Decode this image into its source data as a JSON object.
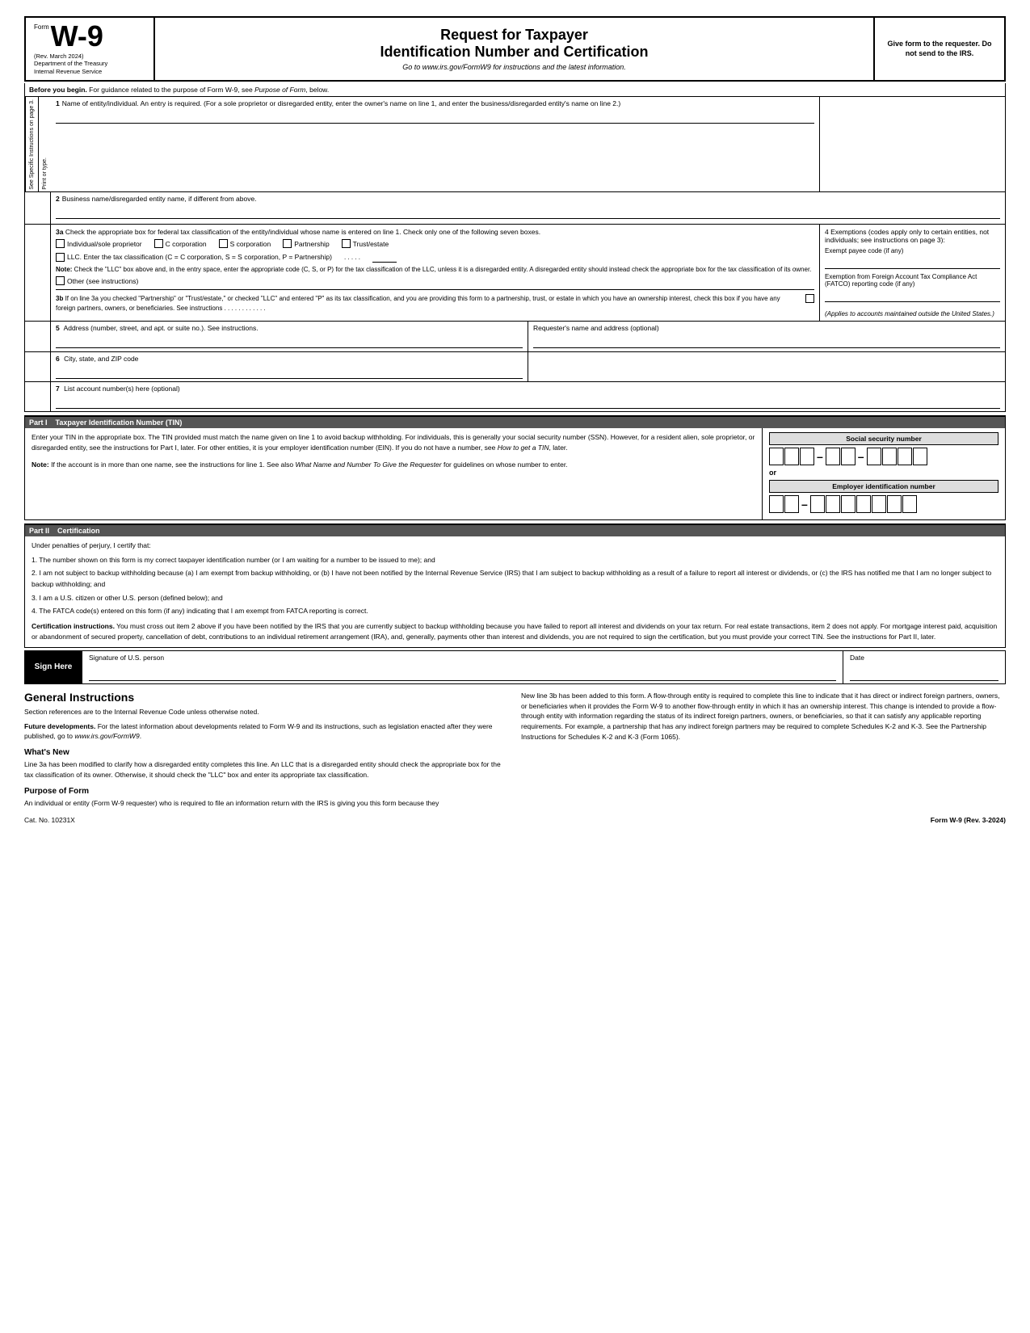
{
  "header": {
    "form_label": "Form",
    "form_number": "W-9",
    "rev_date": "(Rev. March 2024)",
    "dept1": "Department of the Treasury",
    "dept2": "Internal Revenue Service",
    "main_title": "Request for Taxpayer",
    "sub_title": "Identification Number and Certification",
    "go_to_text": "Go to ",
    "go_to_url": "www.irs.gov/FormW9",
    "go_to_suffix": " for instructions and the latest information.",
    "give_form": "Give form to the requester. Do not send to the IRS."
  },
  "before_begin": {
    "label": "Before you begin.",
    "text": " For guidance related to the purpose of Form W-9, see ",
    "italic": "Purpose of Form",
    "suffix": ", below."
  },
  "fields": {
    "field1_num": "1",
    "field1_label": "Name of entity/individual. An entry is required. (For a sole proprietor or disregarded entity, enter the owner's name on line 1, and enter the business/disregarded entity's name on line 2.)",
    "field2_num": "2",
    "field2_label": "Business name/disregarded entity name, if different from above.",
    "field3a_num": "3a",
    "field3a_label": "Check the appropriate box for federal tax classification of the entity/individual whose name is entered on line 1. Check only one of the following seven boxes.",
    "cb_individual": "Individual/sole proprietor",
    "cb_ccorp": "C corporation",
    "cb_scorp": "S corporation",
    "cb_partnership": "Partnership",
    "cb_trust": "Trust/estate",
    "llc_label": "LLC. Enter the tax classification (C = C corporation, S = S corporation, P = Partnership)",
    "note_label": "Note:",
    "note_text": " Check the \"LLC\" box above and, in the entry space, enter the appropriate code (C, S, or P) for the tax classification of the LLC, unless it is a disregarded entity. A disregarded entity should instead check the appropriate box for the tax classification of its owner.",
    "cb_other": "Other (see instructions)",
    "field3b_num": "3b",
    "field3b_text": "If on line 3a you checked \"Partnership\" or \"Trust/estate,\" or checked \"LLC\" and entered \"P\" as its tax classification, and you are providing this form to a partnership, trust, or estate in which you have an ownership interest, check this box if you have any foreign partners, owners, or beneficiaries. See instructions",
    "field4_title": "4 Exemptions (codes apply only to certain entities, not individuals; see instructions on page 3):",
    "exempt_payee": "Exempt payee code (if any)",
    "fatca_label": "Exemption from Foreign Account Tax Compliance Act (FATCO) reporting code (if any)",
    "applies_note": "(Applies to accounts maintained outside the United States.)",
    "field5_num": "5",
    "field5_label": "Address (number, street, and apt. or suite no.). See instructions.",
    "requester_label": "Requester's name and address (optional)",
    "field6_num": "6",
    "field6_label": "City, state, and ZIP code",
    "field7_num": "7",
    "field7_label": "List account number(s) here (optional)"
  },
  "side_labels": {
    "label1": "See Specific Instructions on page 3.",
    "label2": "Print or type."
  },
  "part1": {
    "part_label": "Part I",
    "title": "Taxpayer Identification Number (TIN)",
    "enter_tin_text": "Enter your TIN in the appropriate box. The TIN provided must match the name given on line 1 to avoid backup withholding. For individuals, this is generally your social security number (SSN). However, for a resident alien, sole proprietor, or disregarded entity, see the instructions for Part I, later. For other entities, it is your employer identification number (EIN). If you do not have a number, see ",
    "how_to_get": "How to get a TIN",
    "comma": ", later.",
    "note_label": "Note:",
    "note_text": " If the account is in more than one name, see the instructions for line 1. See also ",
    "what_name": "What Name and Number To Give the Requester",
    "note_suffix": " for guidelines on whose number to enter.",
    "ssn_label": "Social security number",
    "or_text": "or",
    "ein_label": "Employer identification number"
  },
  "part2": {
    "part_label": "Part II",
    "title": "Certification",
    "under_text": "Under penalties of perjury, I certify that:",
    "item1": "1. The number shown on this form is my correct taxpayer identification number (or I am waiting for a number to be issued to me); and",
    "item2": "2. I am not subject to backup withholding because (a) I am exempt from backup withholding, or (b) I have not been notified by the Internal Revenue Service (IRS) that I am subject to backup withholding as a result of a failure to report all interest or dividends, or (c) the IRS has notified me that I am no longer subject to backup withholding; and",
    "item3": "3. I am a U.S. citizen or other U.S. person (defined below); and",
    "item4": "4. The FATCA code(s) entered on this form (if any) indicating that I am exempt from FATCA reporting is correct.",
    "cert_bold_label": "Certification instructions.",
    "cert_instructions": " You must cross out item 2 above if you have been notified by the IRS that you are currently subject to backup withholding because you have failed to report all interest and dividends on your tax return. For real estate transactions, item 2 does not apply. For mortgage interest paid, acquisition or abandonment of secured property, cancellation of debt, contributions to an individual retirement arrangement (IRA), and, generally, payments other than interest and dividends, you are not required to sign the certification, but you must provide your correct TIN. See the instructions for Part II, later."
  },
  "sign": {
    "sign_label": "Sign Here",
    "sig_label": "Signature of U.S. person",
    "date_label": "Date"
  },
  "general": {
    "heading": "General Instructions",
    "section_refs": "Section references are to the Internal Revenue Code unless otherwise noted.",
    "future_bold": "Future developments.",
    "future_text": " For the latest information about developments related to Form W-9 and its instructions, such as legislation enacted after they were published, go to ",
    "future_url": "www.irs.gov/FormW9",
    "future_period": ".",
    "whats_new_heading": "What's New",
    "whats_new_text": "Line 3a has been modified to clarify how a disregarded entity completes this line. An LLC that is a disregarded entity should check the appropriate box for the tax classification of its owner. Otherwise, it should check the \"LLC\" box and enter its appropriate tax classification.",
    "purpose_heading": "Purpose of Form",
    "purpose_text": "An individual or entity (Form W-9 requester) who is required to file an information return with the IRS is giving you this form because they",
    "right_col_text": "New line 3b has been added to this form. A flow-through entity is required to complete this line to indicate that it has direct or indirect foreign partners, owners, or beneficiaries when it provides the Form W-9 to another flow-through entity in which it has an ownership interest. This change is intended to provide a flow-through entity with information regarding the status of its indirect foreign partners, owners, or beneficiaries, so that it can satisfy any applicable reporting requirements. For example, a partnership that has any indirect foreign partners may be required to complete Schedules K-2 and K-3. See the Partnership Instructions for Schedules K-2 and K-3 (Form 1065)."
  },
  "footer": {
    "cat_no": "Cat. No. 10231X",
    "form_label": "Form W-9 (Rev. 3-2024)"
  }
}
